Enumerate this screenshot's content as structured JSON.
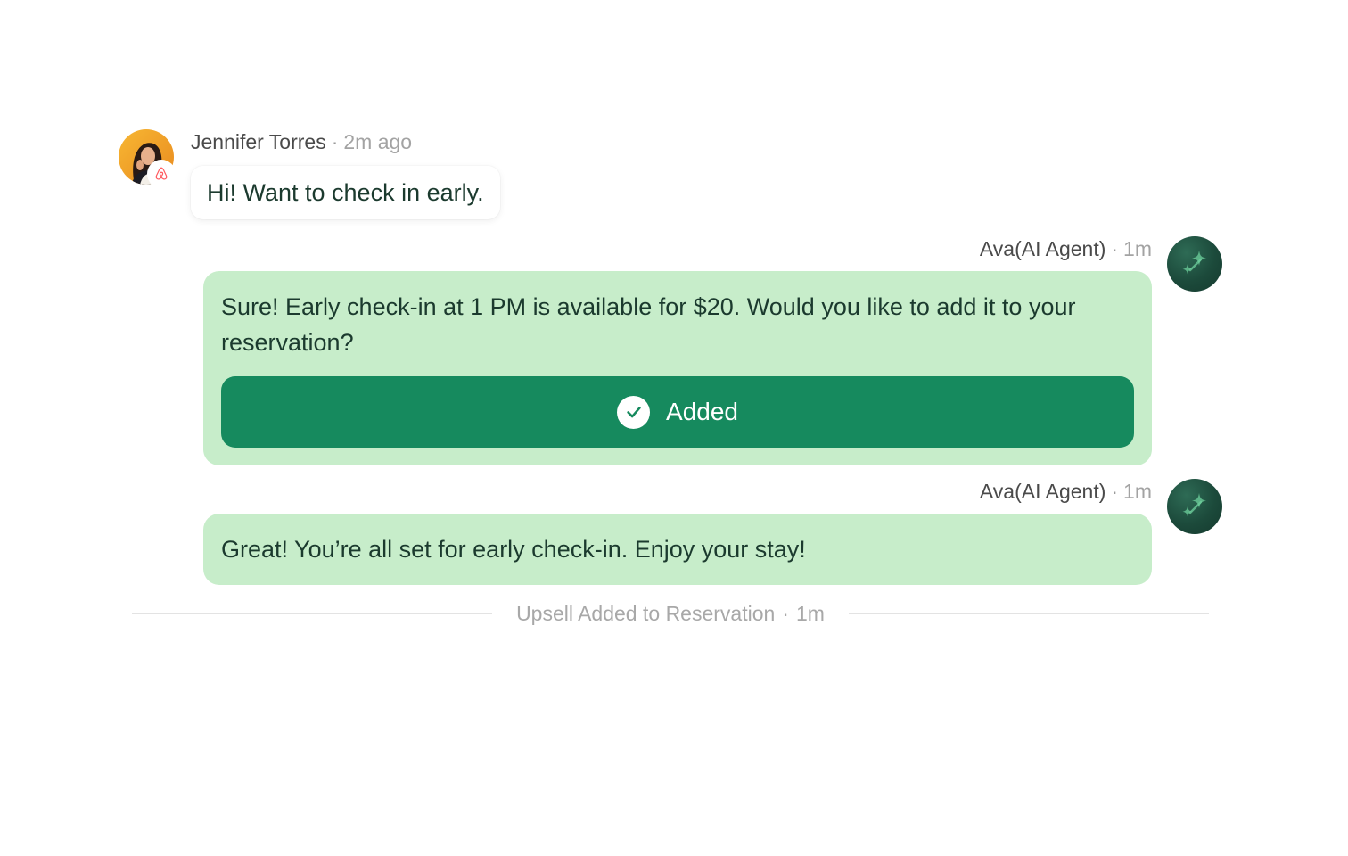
{
  "guest_message": {
    "sender": "Jennifer Torres",
    "time": "2m ago",
    "text": "Hi! Want to check in early.",
    "platform_icon": "airbnb-icon"
  },
  "ai_messages": [
    {
      "sender": "Ava(AI Agent)",
      "time": "1m",
      "text": "Sure! Early check-in at 1 PM is available for $20. Would you like to add it to your reservation?",
      "button_label": "Added",
      "button_icon": "check-icon"
    },
    {
      "sender": "Ava(AI Agent)",
      "time": "1m",
      "text": "Great! You’re all set for early check-in. Enjoy your stay!"
    }
  ],
  "event_divider": {
    "text": "Upsell Added to Reservation",
    "time": "1m"
  },
  "separator": "·",
  "colors": {
    "bubble_ai": "#c7edca",
    "button": "#168a5e",
    "avatar_ai": "#1c4a3b",
    "text_dark": "#1b3a2e",
    "airbnb": "#ff5a5f"
  }
}
